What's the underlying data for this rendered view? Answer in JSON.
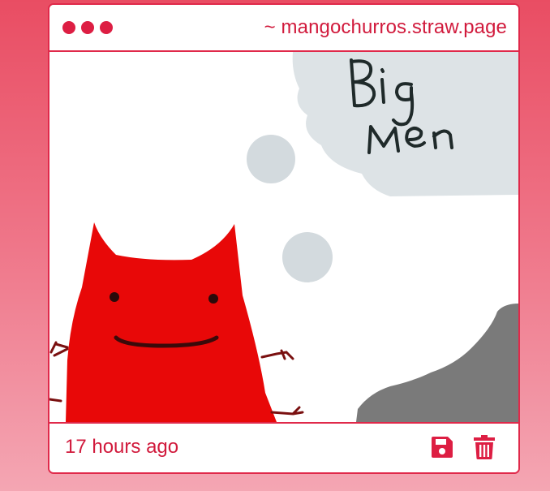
{
  "window": {
    "url": "~ mangochurros.straw.page",
    "controls": [
      "close",
      "minimize",
      "maximize"
    ]
  },
  "drawing": {
    "thought_text_line1": "Big",
    "thought_text_line2": "Men"
  },
  "footer": {
    "timestamp": "17 hours ago",
    "save_icon": "floppy-disk-icon",
    "delete_icon": "trash-icon"
  },
  "colors": {
    "accent": "#e0294a",
    "text": "#d11a3c",
    "creature": "#e80808",
    "cloud": "#dde3e6",
    "grey_shape": "#7a7a7a"
  }
}
